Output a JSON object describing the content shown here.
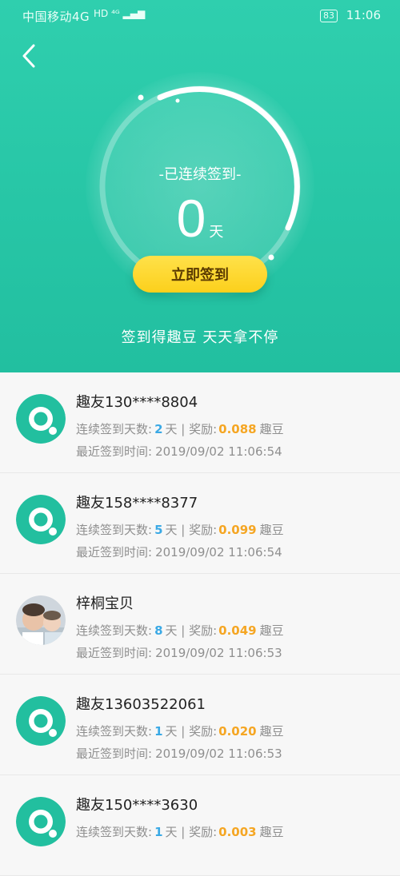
{
  "status_bar": {
    "carrier": "中国移动4G",
    "network_icons": "HD ⁴ᴳ ▂▄▆",
    "battery": "83",
    "time": "11:06"
  },
  "header": {
    "back_icon": "chevron-left-icon",
    "subtitle": "-已连续签到-",
    "days_value": "0",
    "days_unit": "天",
    "signin_button": "立即签到",
    "slogan": "签到得趣豆 天天拿不停"
  },
  "labels": {
    "streak_prefix": "连续签到天数:",
    "streak_suffix": "天 | 奖励:",
    "reward_unit": "趣豆",
    "last_time_prefix": "最近签到时间:"
  },
  "records": [
    {
      "name": "趣友130****8804",
      "days": "2",
      "reward": "0.088",
      "time": "2019/09/02 11:06:54",
      "avatar": "logo"
    },
    {
      "name": "趣友158****8377",
      "days": "5",
      "reward": "0.099",
      "time": "2019/09/02 11:06:54",
      "avatar": "logo"
    },
    {
      "name": "梓桐宝贝",
      "days": "8",
      "reward": "0.049",
      "time": "2019/09/02 11:06:53",
      "avatar": "photo"
    },
    {
      "name": "趣友13603522061",
      "days": "1",
      "reward": "0.020",
      "time": "2019/09/02 11:06:53",
      "avatar": "logo"
    },
    {
      "name": "趣友150****3630",
      "days": "1",
      "reward": "0.003",
      "time": "",
      "avatar": "logo"
    }
  ],
  "colors": {
    "header_green": "#2bc9a8",
    "button_yellow": "#fcd01c",
    "days_blue": "#3aa9e5",
    "reward_orange": "#f5a623"
  }
}
